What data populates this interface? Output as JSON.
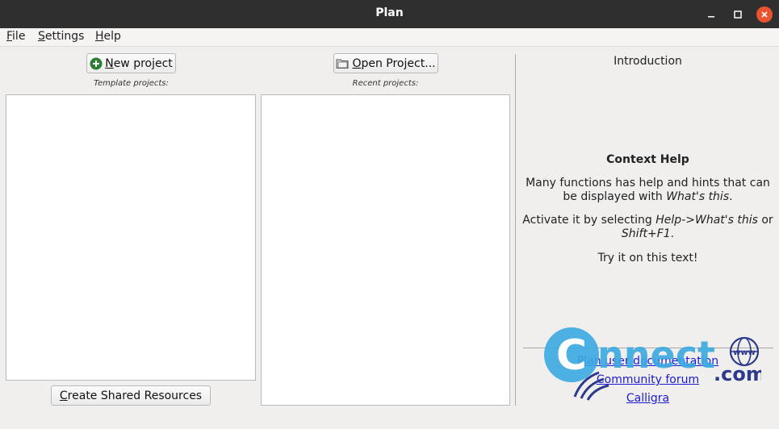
{
  "window": {
    "title": "Plan"
  },
  "menu": {
    "file": {
      "accel": "F",
      "rest": "ile"
    },
    "settings": {
      "accel": "S",
      "rest": "ettings"
    },
    "help": {
      "accel": "H",
      "rest": "elp"
    }
  },
  "left": {
    "new_project": {
      "accel": "N",
      "rest": "ew project"
    },
    "template_caption": "Template projects:",
    "create_shared": {
      "accel": "C",
      "rest": "reate Shared Resources"
    }
  },
  "middle": {
    "open_project": {
      "accel": "O",
      "rest": "pen Project..."
    },
    "recent_caption": "Recent projects:"
  },
  "right": {
    "intro_title": "Introduction",
    "help_title": "Context Help",
    "para1_a": "Many functions has help and hints that can be displayed with ",
    "para1_em": "What's this",
    "para1_b": ".",
    "para2_a": "Activate it by selecting ",
    "para2_em1": "Help->What's this",
    "para2_b": " or ",
    "para2_em2": "Shift+F1",
    "para2_c": ".",
    "para3": "Try it on this text!",
    "links": {
      "docs": "Plan user documentation",
      "forum": "Community forum",
      "calligra": "Calligra"
    }
  },
  "watermark": {
    "text1": "C",
    "text2": "nnect",
    "text3": ".com",
    "www": "www"
  },
  "colors": {
    "titlebar": "#2f2f2f",
    "close": "#e9542e",
    "link": "#1a1ad6",
    "add_icon": "#2e7d32",
    "watermark_blue": "#3aa9e0",
    "watermark_dark": "#2d3a8c"
  }
}
